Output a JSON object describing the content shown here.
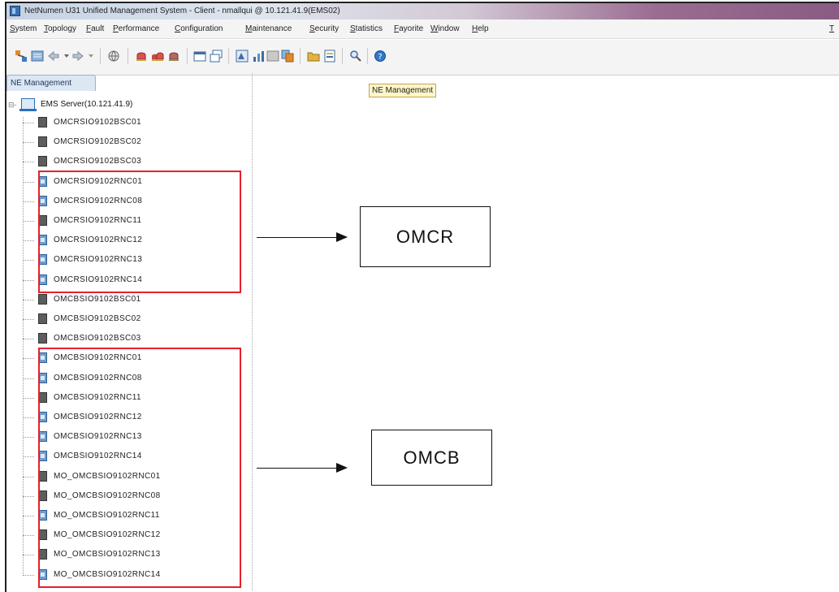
{
  "window": {
    "title": "NetNumen U31 Unified Management System - Client - nmallqui @ 10.121.41.9(EMS02)"
  },
  "menu": {
    "items": [
      "System",
      "Topology",
      "Fault",
      "Performance",
      "Configuration",
      "Maintenance",
      "Security",
      "Statistics",
      "Fayorite",
      "Window",
      "Help"
    ],
    "overflow": "T"
  },
  "toolbar": {
    "icons": [
      "topology-icon",
      "list-icon",
      "back-arrow-icon",
      "dropdown-arrow-icon",
      "forward-arrow-icon",
      "dropdown-arrow-icon",
      "globe-icon",
      "alarm-icon",
      "alarm-group-icon",
      "alarm-history-icon",
      "window-icon",
      "window-restore-icon",
      "config-icon",
      "chart-icon",
      "table-icon",
      "copy-icon",
      "folder-icon",
      "report-icon",
      "search-icon",
      "help-icon"
    ]
  },
  "tab": {
    "label": "NE Management"
  },
  "tooltip": {
    "text": "NE Management"
  },
  "tree": {
    "root": "EMS Server(10.121.41.9)",
    "nodes": [
      "OMCRSIO9102BSC01",
      "OMCRSIO9102BSC02",
      "OMCRSIO9102BSC03",
      "OMCRSIO9102RNC01",
      "OMCRSIO9102RNC08",
      "OMCRSIO9102RNC11",
      "OMCRSIO9102RNC12",
      "OMCRSIO9102RNC13",
      "OMCRSIO9102RNC14",
      "OMCBSIO9102BSC01",
      "OMCBSIO9102BSC02",
      "OMCBSIO9102BSC03",
      "OMCBSIO9102RNC01",
      "OMCBSIO9102RNC08",
      "OMCBSIO9102RNC11",
      "OMCBSIO9102RNC12",
      "OMCBSIO9102RNC13",
      "OMCBSIO9102RNC14",
      "MO_OMCBSIO9102RNC01",
      "MO_OMCBSIO9102RNC08",
      "MO_OMCBSIO9102RNC11",
      "MO_OMCBSIO9102RNC12",
      "MO_OMCBSIO9102RNC13",
      "MO_OMCBSIO9102RNC14"
    ]
  },
  "annotations": {
    "omcr": "OMCR",
    "omcb": "OMCB"
  },
  "colors": {
    "highlight": "#e5202a",
    "tab": "#dde7f3",
    "tooltip": "#fff7c8"
  }
}
